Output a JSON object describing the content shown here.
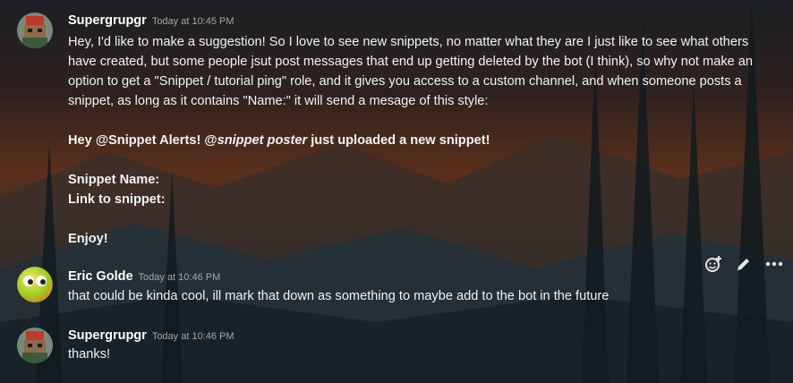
{
  "messages": [
    {
      "author": "Supergrupgr",
      "timestamp": "Today at 10:45 PM",
      "lines": [
        "Hey, I'd like to make a suggestion! So I love to see new snippets, no matter what they are I just like to see what others have created, but some people jsut post messages that end up getting deleted by the bot (I think), so why not make an option to get a \"Snippet / tutorial ping\" role, and it gives you access to a custom channel, and when someone posts a snippet, as long as it contains \"Name:\" it will send a mesage of this style:"
      ],
      "alert_prefix": "Hey @Snippet Alerts! @",
      "alert_italic": "snippet poster",
      "alert_suffix": " just uploaded a new snippet!",
      "field1": "Snippet Name:",
      "field2": "Link to snippet:",
      "closing": "Enjoy!"
    },
    {
      "author": "Eric Golde",
      "timestamp": "Today at 10:46 PM",
      "text": "that could be kinda cool, ill mark that down as something to maybe add to the bot in the future"
    },
    {
      "author": "Supergrupgr",
      "timestamp": "Today at 10:46 PM",
      "text": "thanks!"
    }
  ],
  "toolbar": {
    "icons": [
      "add-reaction-icon",
      "edit-icon",
      "more-options-icon"
    ]
  },
  "colors": {
    "text": "#f2f3f5",
    "timestamp": "#a3a6aa",
    "author": "#ffffff"
  }
}
